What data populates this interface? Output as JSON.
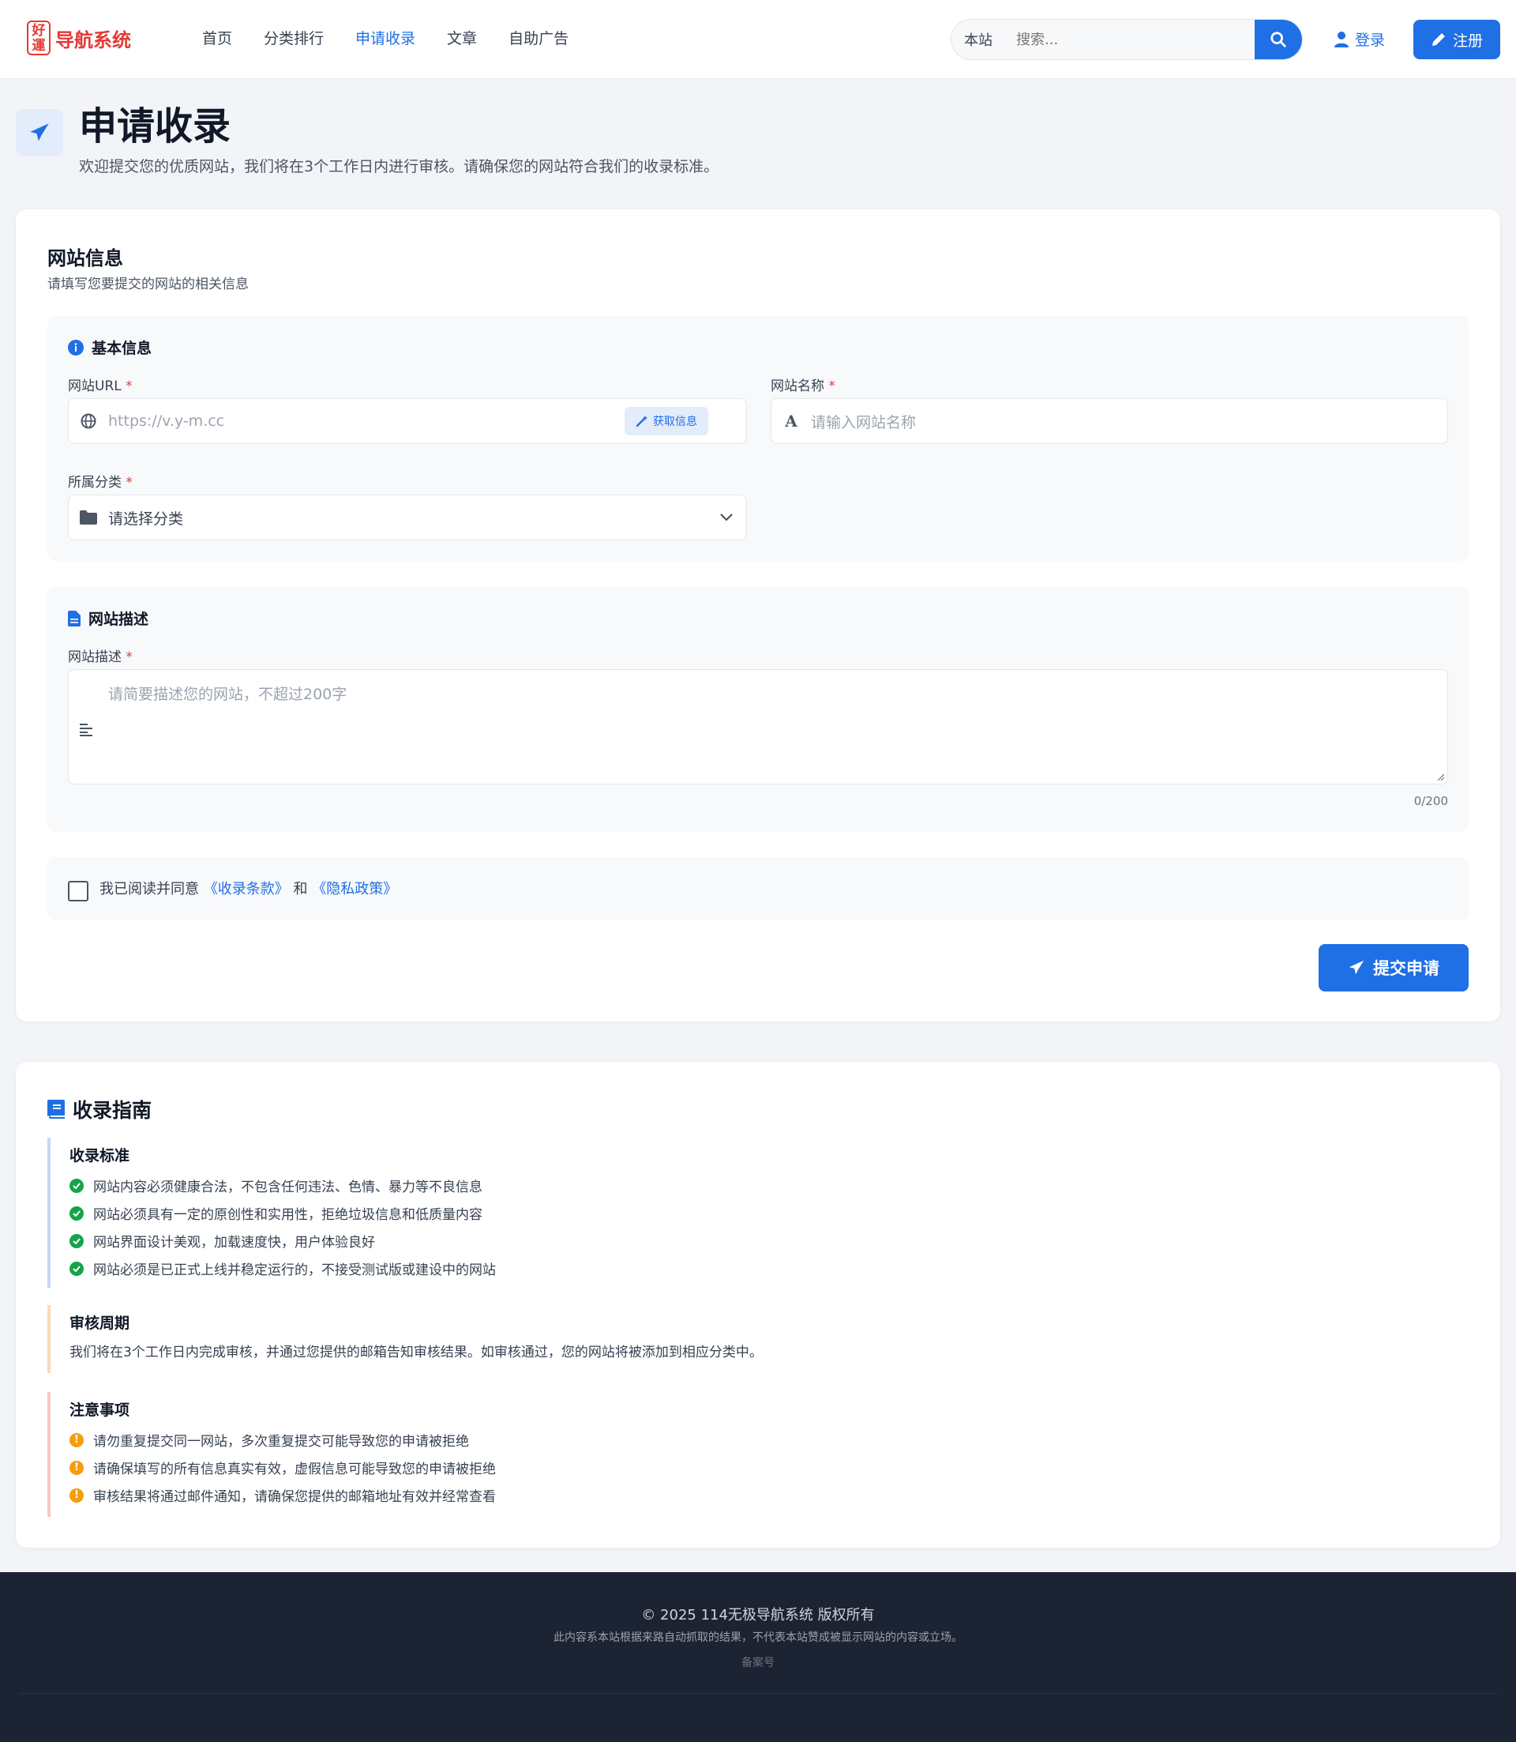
{
  "header": {
    "logo_badge": "好運",
    "logo_text": "导航系统",
    "nav": [
      "首页",
      "分类排行",
      "申请收录",
      "文章",
      "自助广告"
    ],
    "search_scope": "本站",
    "search_placeholder": "搜索...",
    "login": "登录",
    "register": "注册"
  },
  "page": {
    "title": "申请收录",
    "subtitle": "欢迎提交您的优质网站，我们将在3个工作日内进行审核。请确保您的网站符合我们的收录标准。"
  },
  "form": {
    "title": "网站信息",
    "subtitle": "请填写您要提交的网站的相关信息",
    "basic": {
      "heading": "基本信息",
      "url_label": "网站URL",
      "url_placeholder": "https://v.y-m.cc",
      "fetch_button": "获取信息",
      "name_label": "网站名称",
      "name_placeholder": "请输入网站名称",
      "category_label": "所属分类",
      "category_value": "请选择分类"
    },
    "desc": {
      "heading": "网站描述",
      "label": "网站描述",
      "placeholder": "请简要描述您的网站，不超过200字",
      "counter": "0/200"
    },
    "agree": {
      "prefix": "我已阅读并同意",
      "terms": "《收录条款》",
      "and": "和",
      "privacy": "《隐私政策》"
    },
    "required_mark": "*",
    "submit": "提交申请"
  },
  "guide": {
    "title": "收录指南",
    "standard_title": "收录标准",
    "standards": [
      "网站内容必须健康合法，不包含任何违法、色情、暴力等不良信息",
      "网站必须具有一定的原创性和实用性，拒绝垃圾信息和低质量内容",
      "网站界面设计美观，加载速度快，用户体验良好",
      "网站必须是已正式上线并稳定运行的，不接受测试版或建设中的网站"
    ],
    "cycle_title": "审核周期",
    "cycle_text": "我们将在3个工作日内完成审核，并通过您提供的邮箱告知审核结果。如审核通过，您的网站将被添加到相应分类中。",
    "notes_title": "注意事项",
    "warn_mark": "!",
    "notes": [
      "请勿重复提交同一网站，多次重复提交可能导致您的申请被拒绝",
      "请确保填写的所有信息真实有效，虚假信息可能导致您的申请被拒绝",
      "审核结果将通过邮件通知，请确保您提供的邮箱地址有效并经常查看"
    ]
  },
  "footer": {
    "copyright": "© 2025 114无极导航系统 版权所有",
    "disclaimer": "此内容系本站根据来路自动抓取的结果，不代表本站赞成被显示网站的内容或立场。",
    "icp": "备案号"
  },
  "colors": {
    "primary": "#1f6fe5",
    "brand_red": "#e53935",
    "footer_bg": "#1c2333"
  }
}
